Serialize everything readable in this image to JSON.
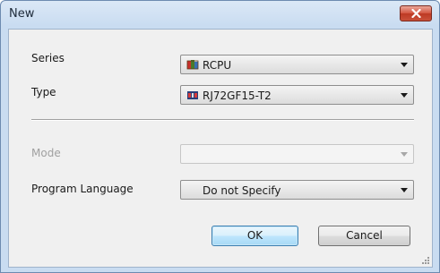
{
  "window": {
    "title": "New"
  },
  "form": {
    "series": {
      "label": "Series",
      "value": "RCPU",
      "icon": "rcpu-module-icon"
    },
    "type": {
      "label": "Type",
      "value": "RJ72GF15-T2",
      "icon": "network-module-icon"
    },
    "mode": {
      "label": "Mode",
      "value": "",
      "enabled": false
    },
    "program_language": {
      "label": "Program Language",
      "value": "Do not Specify"
    }
  },
  "buttons": {
    "ok": "OK",
    "cancel": "Cancel"
  },
  "colors": {
    "title_gradient_top": "#dbe8f6",
    "client_bg": "#f0f0f0",
    "close_red": "#c9503a",
    "default_button_border": "#3c7fb1"
  }
}
